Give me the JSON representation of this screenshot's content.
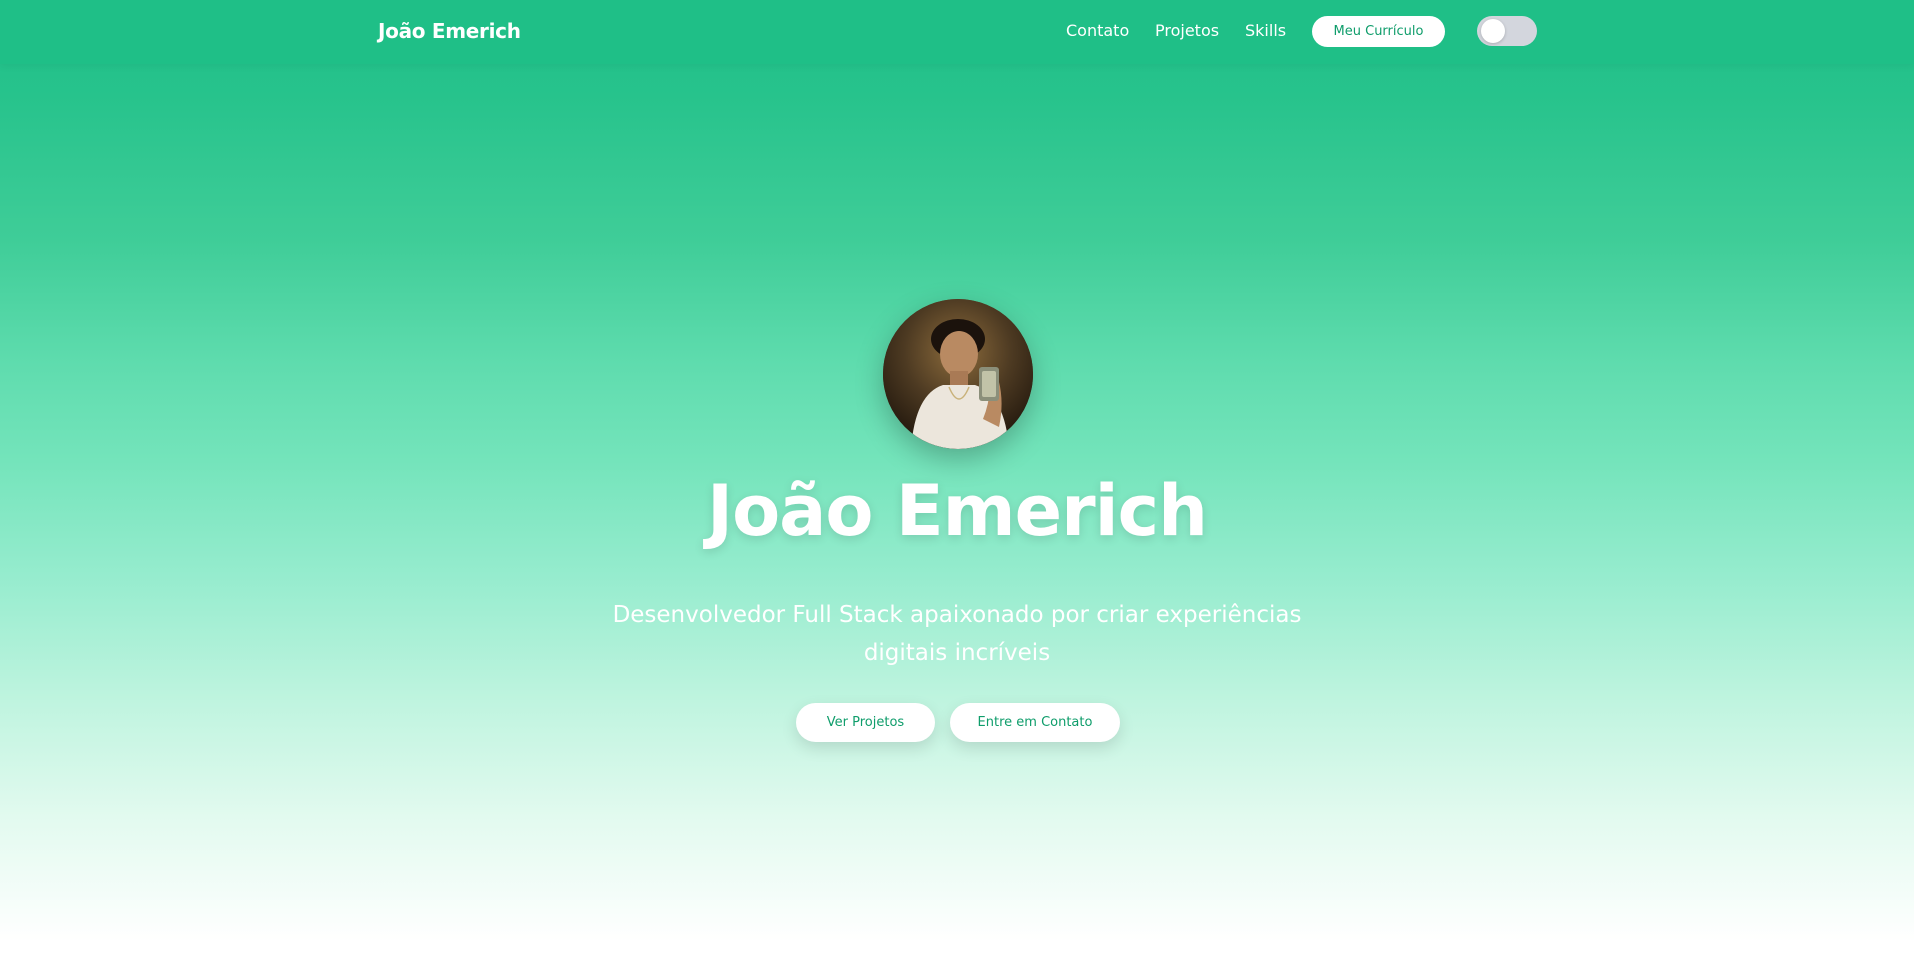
{
  "navbar": {
    "brand": "João Emerich",
    "links": [
      {
        "label": "Contato"
      },
      {
        "label": "Projetos"
      },
      {
        "label": "Skills"
      }
    ],
    "resume_label": "Meu Currículo",
    "theme_toggle_on": false
  },
  "hero": {
    "title": "João Emerich",
    "subtitle": "Desenvolvedor Full Stack apaixonado por criar experiências digitais incríveis",
    "buttons": [
      {
        "label": "Ver Projetos"
      },
      {
        "label": "Entre em Contato"
      }
    ]
  },
  "colors": {
    "accent": "#1fbf87",
    "button_text": "#0f9d6b",
    "white": "#ffffff",
    "toggle_off": "#d3d6dd"
  }
}
